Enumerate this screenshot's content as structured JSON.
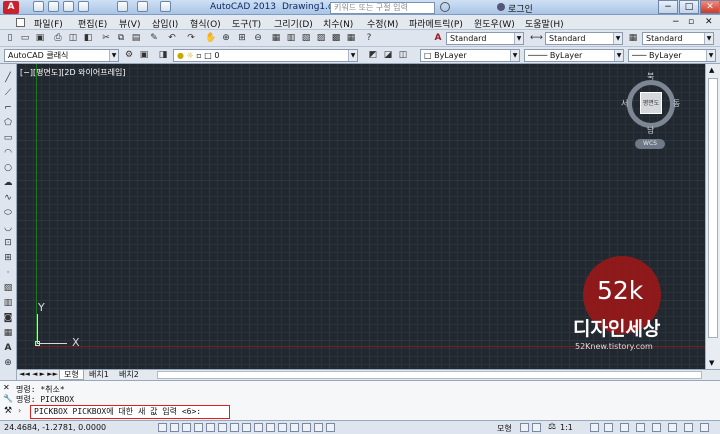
{
  "titlebar": {
    "app_title": "AutoCAD 2013",
    "doc_title": "Drawing1.dwg",
    "search_placeholder": "키워드 또는 구절 입력",
    "login": "로그인"
  },
  "menu": [
    "파일(F)",
    "편집(E)",
    "뷰(V)",
    "삽입(I)",
    "형식(O)",
    "도구(T)",
    "그리기(D)",
    "치수(N)",
    "수정(M)",
    "파라메트릭(P)",
    "윈도우(W)",
    "도움말(H)"
  ],
  "toolbar1": {
    "text_style": "Standard",
    "dim_style": "Standard",
    "table_style": "Standard"
  },
  "toolbar2": {
    "workspace": "AutoCAD 클래식",
    "layer": "0",
    "color": "ByLayer",
    "linetype": "ByLayer",
    "lineweight": "ByLayer"
  },
  "viewport": {
    "label": "[−][평면도][2D 와이어프레임]"
  },
  "viewcube": {
    "north": "북",
    "south": "남",
    "east": "동",
    "west": "서",
    "face": "평면도",
    "wcs": "WCS"
  },
  "ucs": {
    "y": "Y",
    "x": "X"
  },
  "watermark": {
    "number": "52k",
    "brand": "디자인세상",
    "url": "52Knew.tistory.com"
  },
  "layout_tabs": [
    "모형",
    "배치1",
    "배치2"
  ],
  "command": {
    "history": [
      "명령: *취소*",
      "명령: PICKBOX"
    ],
    "prompt": "PICKBOX PICKBOX에 대한 새 값 입력 <6>:"
  },
  "status": {
    "coords": "24.4684, -1.2781, 0.0000",
    "model": "모형",
    "scale": "1:1"
  }
}
